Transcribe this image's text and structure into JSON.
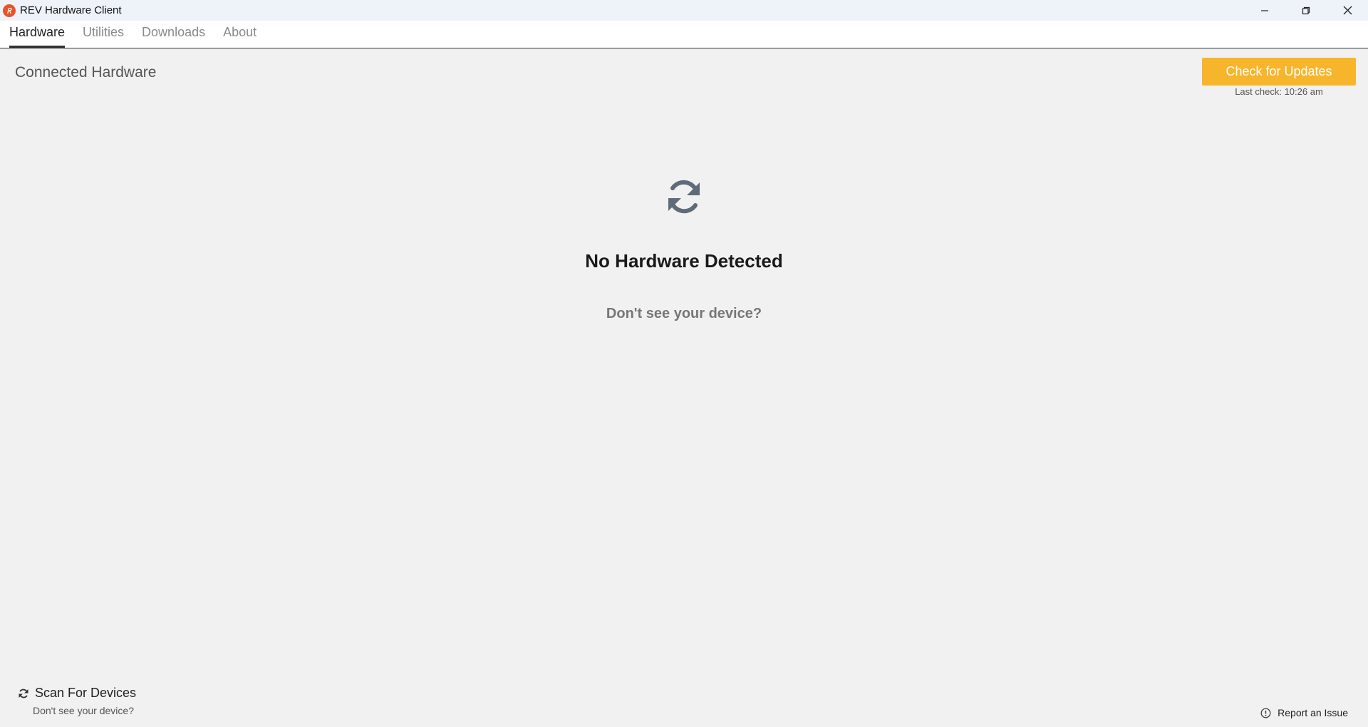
{
  "window": {
    "title": "REV Hardware Client"
  },
  "tabs": [
    {
      "label": "Hardware",
      "active": true
    },
    {
      "label": "Utilities",
      "active": false
    },
    {
      "label": "Downloads",
      "active": false
    },
    {
      "label": "About",
      "active": false
    }
  ],
  "main": {
    "section_title": "Connected Hardware",
    "update_button": "Check for Updates",
    "last_check": "Last check: 10:26 am",
    "empty_title": "No Hardware Detected",
    "empty_subtitle": "Don't see your device?"
  },
  "footer": {
    "scan_label": "Scan For Devices",
    "scan_sub": "Don't see your device?",
    "report_label": "Report an Issue"
  },
  "colors": {
    "accent": "#f7b52c",
    "logo": "#e8542a",
    "background": "#f1f1f1"
  },
  "icons": {
    "logo": "rev-logo-icon",
    "minimize": "minimize-icon",
    "restore": "restore-icon",
    "close": "close-icon",
    "empty_state": "sync-icon",
    "scan": "sync-icon",
    "report": "info-circle-icon"
  }
}
